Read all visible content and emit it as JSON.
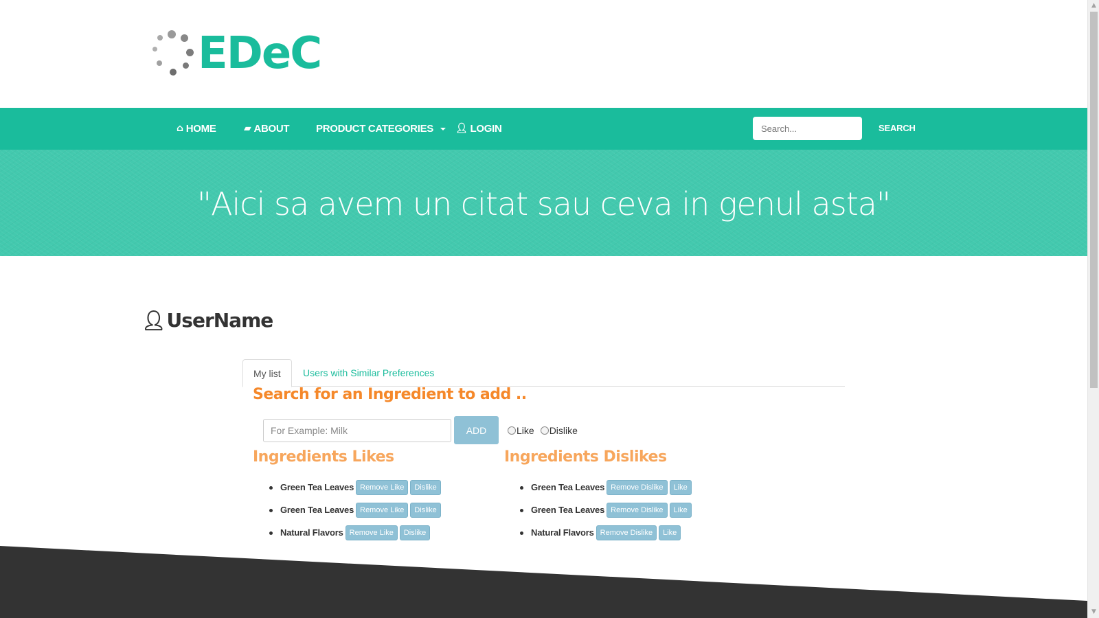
{
  "brand": {
    "name": "EDeC"
  },
  "nav": {
    "items": [
      {
        "label": "HOME",
        "icon": "home-icon"
      },
      {
        "label": "ABOUT",
        "icon": "book-icon"
      },
      {
        "label": "PRODUCT CATEGORIES",
        "icon": "chevron-down-icon"
      },
      {
        "label": "LOGIN",
        "icon": "user-icon"
      }
    ],
    "search_placeholder": "Search...",
    "search_label": "SEARCH"
  },
  "hero": {
    "quote": "\"Aici sa avem un citat sau ceva in genul asta\""
  },
  "user": {
    "name": "UserName"
  },
  "tabs": [
    {
      "label": "My list",
      "active": true
    },
    {
      "label": "Users with Similar Preferences",
      "active": false
    }
  ],
  "add_ingredient": {
    "title": "Search for an Ingredient to add ..",
    "placeholder": "For Example: Milk",
    "add_label": "ADD",
    "option_like": "Like",
    "option_dislike": "Dislike"
  },
  "likes": {
    "title": "Ingredients Likes",
    "remove_label": "Remove Like",
    "toggle_label": "Dislike",
    "items": [
      "Green Tea Leaves",
      "Green Tea Leaves",
      "Natural Flavors"
    ]
  },
  "dislikes": {
    "title": "Ingredients Dislikes",
    "remove_label": "Remove Dislike",
    "toggle_label": "Like",
    "items": [
      "Green Tea Leaves",
      "Green Tea Leaves",
      "Natural Flavors"
    ]
  },
  "colors": {
    "accent": "#1abc9c",
    "orange": "#f5882a",
    "button": "#8fc1d6",
    "footer": "#333333"
  }
}
